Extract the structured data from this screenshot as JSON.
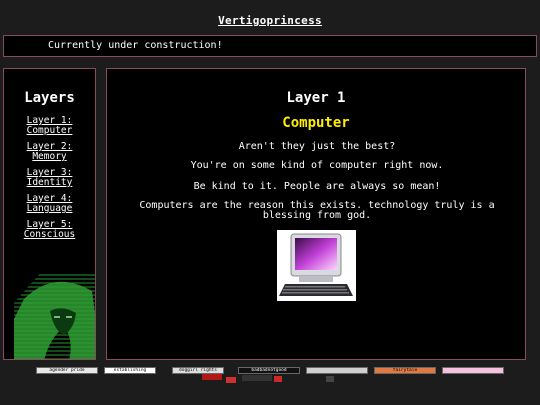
{
  "site": {
    "title": "Vertigoprincess"
  },
  "banner": {
    "text": "Currently under construction!"
  },
  "sidebar": {
    "heading": "Layers",
    "items": [
      {
        "line1": "Layer 1:",
        "line2": "Computer"
      },
      {
        "line1": "Layer 2:",
        "line2": "Memory"
      },
      {
        "line1": "Layer 3:",
        "line2": "Identity"
      },
      {
        "line1": "Layer 4:",
        "line2": "Language"
      },
      {
        "line1": "Layer 5:",
        "line2": "Conscious"
      }
    ]
  },
  "main": {
    "layer_title": "Layer 1",
    "subtitle": "Computer",
    "paragraphs": [
      "Aren't they just the best?",
      "You're on some kind of computer right now.",
      "Be kind to it. People are always so mean!",
      "Computers are the reason this exists. technology truly is a blessing from god."
    ]
  },
  "footer": {
    "buttons": [
      {
        "label": "agender pride",
        "bg": "#e8e8e8"
      },
      {
        "label": "establishing connection",
        "bg": "#ffffff"
      },
      {
        "label": "doggirl rights",
        "bg": "#dcdcdc"
      },
      {
        "label": "badbadnotgood",
        "bg": "#111111"
      },
      {
        "label": "",
        "bg": "#d0d0d0"
      },
      {
        "label": "fairytale",
        "bg": "#e07a40"
      },
      {
        "label": "",
        "bg": "#f4c2dc"
      }
    ]
  },
  "colors": {
    "background": "#1c1c1c",
    "panel": "#000000",
    "border": "#8a4a5e",
    "accent": "#ffee00"
  }
}
